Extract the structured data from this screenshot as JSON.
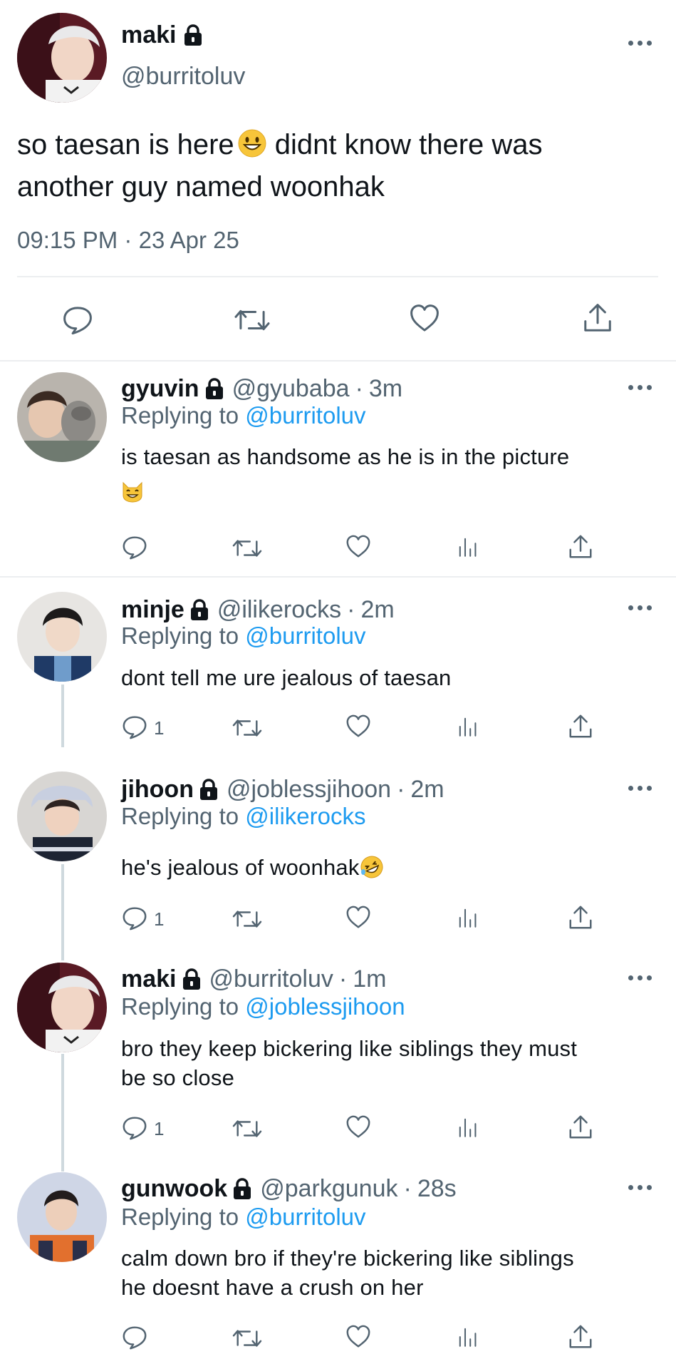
{
  "main_tweet": {
    "author_name": "maki",
    "author_handle": "@burritoluv",
    "text_line1": "so taesan is here",
    "text_line1_rest": " didnt know there was",
    "text_line2": "another guy named woonhak",
    "time": "09:15 PM",
    "date": "23 Apr 25",
    "emoji_icon": "grinning-face-icon"
  },
  "replies": [
    {
      "name": "gyuvin",
      "handle": "@gyubaba",
      "time": "3m",
      "reply_prefix": "Replying to",
      "reply_to": "@burritoluv",
      "text": "is taesan as handsome as he is in the picture",
      "emoji_icon": "smiling-cat-icon",
      "reply_count": ""
    },
    {
      "name": "minje",
      "handle": "@ilikerocks",
      "time": "2m",
      "reply_prefix": "Replying to",
      "reply_to": "@burritoluv",
      "text": "dont tell me ure jealous of taesan",
      "reply_count": "1"
    },
    {
      "name": "jihoon",
      "handle": "@joblessjihoon",
      "time": "2m",
      "reply_prefix": "Replying to",
      "reply_to": "@ilikerocks",
      "text": "he's jealous of woonhak",
      "emoji_icon": "rofl-face-icon",
      "reply_count": "1"
    },
    {
      "name": "maki",
      "handle": "@burritoluv",
      "time": "1m",
      "reply_prefix": "Replying to",
      "reply_to": "@joblessjihoon",
      "text_line1": "bro they keep bickering like siblings they must",
      "text_line2": "be so close",
      "reply_count": "1"
    },
    {
      "name": "gunwook",
      "handle": "@parkgunuk",
      "time": "28s",
      "reply_prefix": "Replying to",
      "reply_to": "@burritoluv",
      "text_line1": "calm down bro if they're bickering like siblings",
      "text_line2": "he doesnt have a crush on her",
      "reply_count": ""
    }
  ],
  "separator": "·",
  "icons": [
    "reply-icon",
    "retweet-icon",
    "like-icon",
    "views-icon",
    "share-icon",
    "lock-icon",
    "more-icon"
  ],
  "colors": {
    "text": "#0f1419",
    "secondary": "#536471",
    "link": "#1d9bf0",
    "divider": "#eceef0"
  }
}
